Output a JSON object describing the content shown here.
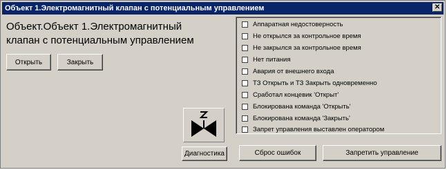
{
  "window": {
    "title": "Объект 1.Электромагнитный клапан с потенциальным управлением",
    "close_glyph": "✕"
  },
  "object": {
    "heading_line1": "Объект.Объект 1.Электромагнитный",
    "heading_line2": "клапан с потенциальным управлением"
  },
  "controls": {
    "open_label": "Открыть",
    "close_label": "Закрыть",
    "diagnostics_label": "Диагностика",
    "reset_errors_label": "Сброс ошибок",
    "forbid_control_label": "Запретить управление"
  },
  "status_flags": [
    {
      "label": "Аппаратная недостоверность",
      "checked": false
    },
    {
      "label": "Не открылся за контрольное время",
      "checked": false
    },
    {
      "label": "Не закрылся за контрольное время",
      "checked": false
    },
    {
      "label": "Нет питания",
      "checked": false
    },
    {
      "label": "Авария от внешнего входа",
      "checked": false
    },
    {
      "label": "ТЗ Открыть и ТЗ Закрыть одновременно",
      "checked": false
    },
    {
      "label": "Сработал концевик 'Открыт'",
      "checked": false
    },
    {
      "label": "Блокирована команда 'Открыть'",
      "checked": false
    },
    {
      "label": "Блокирована команда 'Закрыть'",
      "checked": false
    },
    {
      "label": "Запрет управления выставлен оператором",
      "checked": false
    }
  ],
  "icons": {
    "valve": "solenoid-valve-icon"
  },
  "colors": {
    "titlebar": "#0a246a",
    "window_bg": "#d4d0c8",
    "valve_symbol": "#000000"
  }
}
